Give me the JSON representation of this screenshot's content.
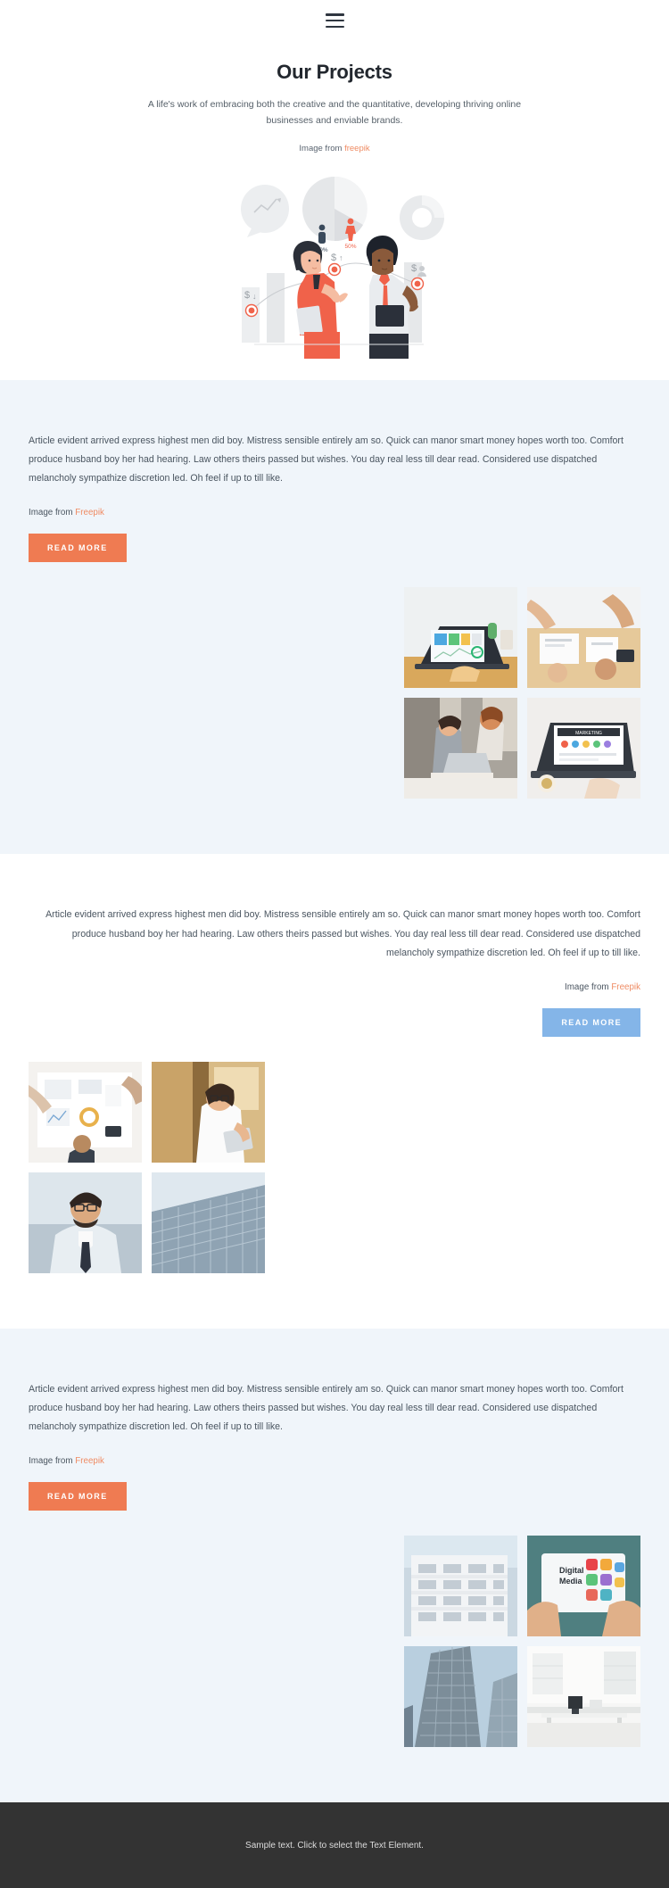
{
  "header": {
    "menu_icon": "hamburger-icon",
    "title": "Our Projects",
    "subtitle": "A life's work of embracing both the creative and the quantitative, developing thriving online businesses and enviable brands.",
    "credit_prefix": "Image from ",
    "credit_link": "freepik"
  },
  "colors": {
    "accent_orange": "#ef7b52",
    "accent_blue": "#84b5e8",
    "link_orange": "#ef8b63",
    "section_alt_bg": "#f0f5fa",
    "footer_bg": "#333333",
    "heading": "#22272e",
    "body_text": "#4a5560"
  },
  "body_copy": "Article evident arrived express highest men did boy. Mistress sensible entirely am so. Quick can manor smart money hopes worth too. Comfort produce husband boy her had hearing. Law others theirs passed but wishes. You day real less till dear read. Considered use dispatched melancholy sympathize discretion led. Oh feel if up to till like.",
  "sections": [
    {
      "id": "section-one",
      "background": "#f0f5fa",
      "align": "left",
      "copy": "Article evident arrived express highest men did boy. Mistress sensible entirely am so. Quick can manor smart money hopes worth too. Comfort produce husband boy her had hearing. Law others theirs passed but wishes. You day real less till dear read. Considered use dispatched melancholy sympathize discretion led. Oh feel if up to till like.",
      "credit_prefix": "Image from ",
      "credit_link": "Freepik",
      "button_label": "READ MORE",
      "button_style": "orange",
      "images": [
        {
          "alt": "laptop-dashboard-desk",
          "theme": "laptop-dashboard"
        },
        {
          "alt": "team-hands-documents-table",
          "theme": "team-documents"
        },
        {
          "alt": "two-women-at-laptop-office",
          "theme": "women-laptop"
        },
        {
          "alt": "marketing-laptop-coffee",
          "theme": "marketing-laptop"
        }
      ]
    },
    {
      "id": "section-two",
      "background": "#ffffff",
      "align": "right",
      "copy": "Article evident arrived express highest men did boy. Mistress sensible entirely am so. Quick can manor smart money hopes worth too. Comfort produce husband boy her had hearing. Law others theirs passed but wishes. You day real less till dear read. Considered use dispatched melancholy sympathize discretion led. Oh feel if up to till like.",
      "credit_prefix": "Image from ",
      "credit_link": "Freepik",
      "button_label": "READ MORE",
      "button_style": "blue",
      "images": [
        {
          "alt": "overhead-meeting-charts-table",
          "theme": "overhead-meeting"
        },
        {
          "alt": "businesswoman-with-tablet",
          "theme": "businesswoman"
        },
        {
          "alt": "bearded-businessman-portrait",
          "theme": "businessman"
        },
        {
          "alt": "glass-office-building-facade",
          "theme": "glass-building"
        }
      ]
    },
    {
      "id": "section-three",
      "background": "#f0f5fa",
      "align": "left",
      "copy": "Article evident arrived express highest men did boy. Mistress sensible entirely am so. Quick can manor smart money hopes worth too. Comfort produce husband boy her had hearing. Law others theirs passed but wishes. You day real less till dear read. Considered use dispatched melancholy sympathize discretion led. Oh feel if up to till like.",
      "credit_prefix": "Image from ",
      "credit_link": "Freepik",
      "button_label": "READ MORE",
      "button_style": "orange",
      "images": [
        {
          "alt": "white-apartment-building",
          "theme": "white-building"
        },
        {
          "alt": "digital-media-tablet-icons",
          "theme": "digital-media"
        },
        {
          "alt": "skyscraper-from-below",
          "theme": "skyscraper"
        },
        {
          "alt": "bright-white-office-interior",
          "theme": "white-office"
        }
      ]
    }
  ],
  "illustration": {
    "alt": "two-business-people-with-data-charts",
    "stat_male": "50%",
    "stat_female": "50%"
  },
  "footer": {
    "text": "Sample text. Click to select the Text Element."
  }
}
